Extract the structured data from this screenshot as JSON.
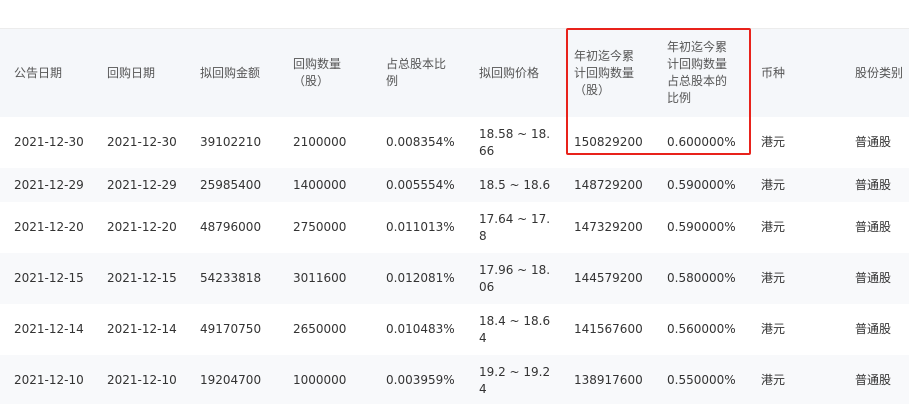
{
  "table": {
    "headers": [
      "公告日期",
      "回购日期",
      "拟回购金额",
      "回购数量\n（股）",
      "占总股本比\n例",
      "拟回购价格",
      "年初迄今累\n计回购数量\n（股）",
      "年初迄今累\n计回购数量\n占总股本的\n比例",
      "币种",
      "股份类别"
    ],
    "rows": [
      [
        "2021-12-30",
        "2021-12-30",
        "39102210",
        "2100000",
        "0.008354%",
        "18.58 ~ 18.66",
        "150829200",
        "0.600000%",
        "港元",
        "普通股"
      ],
      [
        "2021-12-29",
        "2021-12-29",
        "25985400",
        "1400000",
        "0.005554%",
        "18.5 ~ 18.6",
        "148729200",
        "0.590000%",
        "港元",
        "普通股"
      ],
      [
        "2021-12-20",
        "2021-12-20",
        "48796000",
        "2750000",
        "0.011013%",
        "17.64 ~ 17.8",
        "147329200",
        "0.590000%",
        "港元",
        "普通股"
      ],
      [
        "2021-12-15",
        "2021-12-15",
        "54233818",
        "3011600",
        "0.012081%",
        "17.96 ~ 18.06",
        "144579200",
        "0.580000%",
        "港元",
        "普通股"
      ],
      [
        "2021-12-14",
        "2021-12-14",
        "49170750",
        "2650000",
        "0.010483%",
        "18.4 ~ 18.64",
        "141567600",
        "0.560000%",
        "港元",
        "普通股"
      ],
      [
        "2021-12-10",
        "2021-12-10",
        "19204700",
        "1000000",
        "0.003959%",
        "19.2 ~ 19.24",
        "138917600",
        "0.550000%",
        "港元",
        "普通股"
      ]
    ]
  },
  "highlight": {
    "color": "#e8221b",
    "columns": [
      "年初迄今累计回购数量（股）",
      "年初迄今累计回购数量占总股本的比例"
    ]
  },
  "colors": {
    "header_bg": "#f5f7fa",
    "stripe_bg": "#f8f9fb",
    "text": "#333333"
  }
}
